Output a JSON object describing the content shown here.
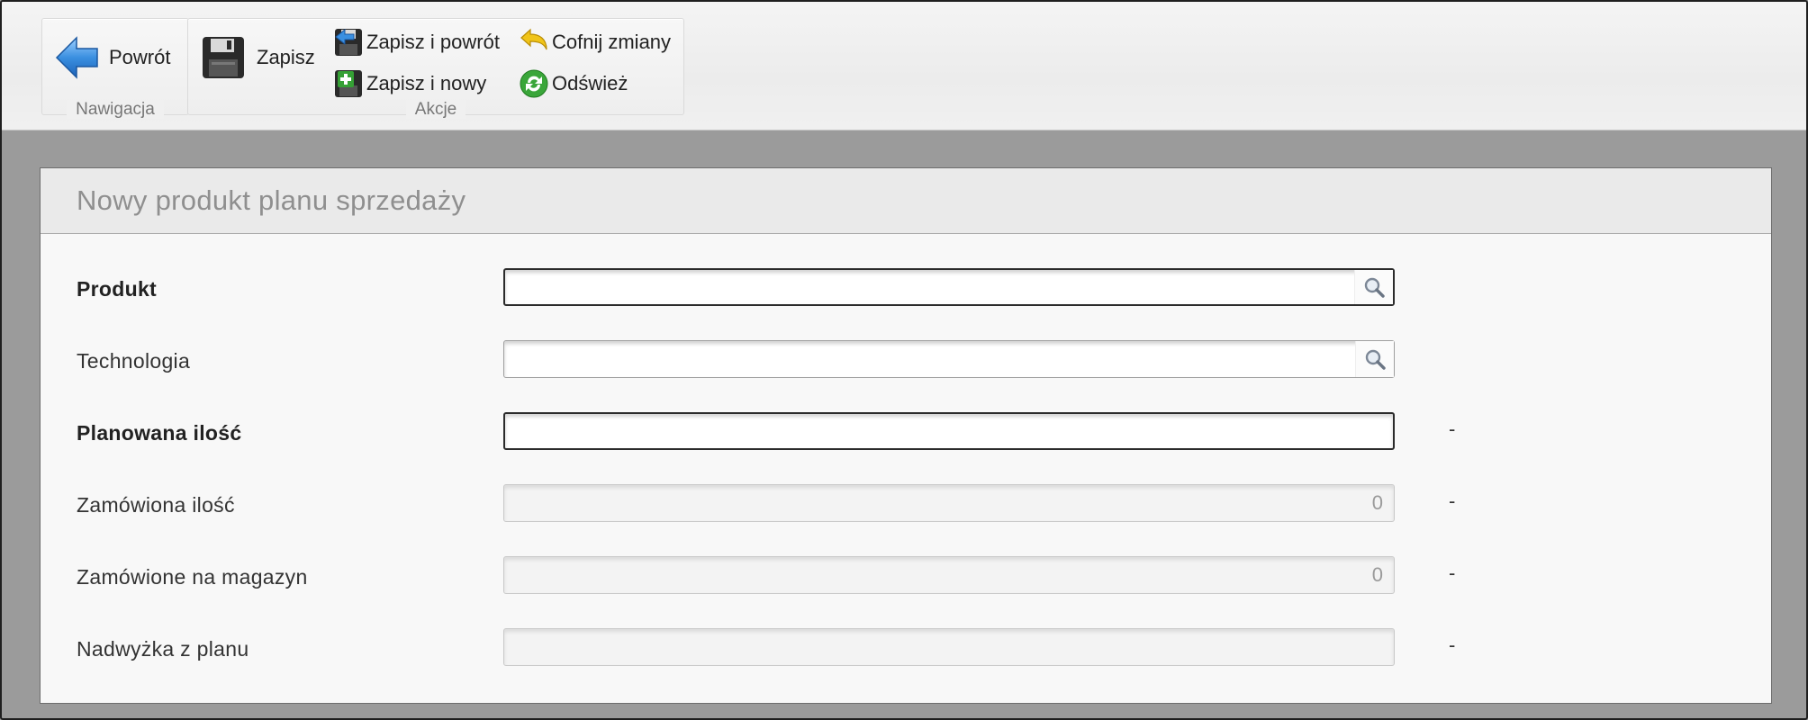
{
  "toolbar": {
    "navigation": {
      "label": "Nawigacja",
      "back_label": "Powrót"
    },
    "actions": {
      "label": "Akcje",
      "save_label": "Zapisz",
      "save_back_label": "Zapisz i powrót",
      "save_new_label": "Zapisz i nowy",
      "undo_label": "Cofnij zmiany",
      "refresh_label": "Odśwież"
    }
  },
  "form": {
    "title": "Nowy produkt planu sprzedaży",
    "fields": {
      "product": {
        "label": "Produkt",
        "value": ""
      },
      "technology": {
        "label": "Technologia",
        "value": ""
      },
      "planned_quantity": {
        "label": "Planowana ilość",
        "value": "",
        "unit": "-"
      },
      "ordered_quantity": {
        "label": "Zamówiona ilość",
        "value": "0",
        "unit": "-"
      },
      "ordered_to_warehouse": {
        "label": "Zamówione na magazyn",
        "value": "0",
        "unit": "-"
      },
      "surplus": {
        "label": "Nadwyżka z planu",
        "value": "",
        "unit": "-"
      }
    }
  },
  "icons": {
    "back": "arrow-left-icon",
    "save": "floppy-disk-icon",
    "save_back": "save-and-back-icon",
    "save_new": "save-and-new-icon",
    "undo": "undo-arrow-icon",
    "refresh": "refresh-icon",
    "lookup": "search-icon"
  },
  "colors": {
    "back_arrow": "#3a8fe0",
    "undo_arrow": "#f0c419",
    "refresh": "#3aa63a",
    "page_bg": "#9b9b9b"
  }
}
